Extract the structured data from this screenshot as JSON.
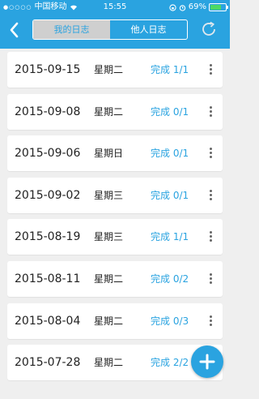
{
  "status_bar": {
    "carrier": "中国移动",
    "time": "15:55",
    "battery": "69%",
    "battery_level": 0.69
  },
  "header": {
    "tabs": [
      {
        "label": "我的日志",
        "active": true
      },
      {
        "label": "他人日志",
        "active": false
      }
    ]
  },
  "logs": [
    {
      "date": "2015-09-15",
      "weekday": "星期二",
      "status": "完成 1/1"
    },
    {
      "date": "2015-09-08",
      "weekday": "星期二",
      "status": "完成 0/1"
    },
    {
      "date": "2015-09-06",
      "weekday": "星期日",
      "status": "完成 0/1"
    },
    {
      "date": "2015-09-02",
      "weekday": "星期三",
      "status": "完成 0/1"
    },
    {
      "date": "2015-08-19",
      "weekday": "星期三",
      "status": "完成 1/1"
    },
    {
      "date": "2015-08-11",
      "weekday": "星期二",
      "status": "完成 0/2"
    },
    {
      "date": "2015-08-04",
      "weekday": "星期二",
      "status": "完成 0/3"
    },
    {
      "date": "2015-07-28",
      "weekday": "星期二",
      "status": "完成 2/2"
    }
  ],
  "colors": {
    "accent": "#2aa3e0",
    "background": "#efefef"
  },
  "icons": {
    "back": "chevron-left-icon",
    "refresh": "refresh-icon",
    "more": "more-vertical-icon",
    "add": "plus-icon",
    "wifi": "wifi-icon",
    "alarm": "alarm-icon",
    "rotation_lock": "rotation-lock-icon"
  }
}
